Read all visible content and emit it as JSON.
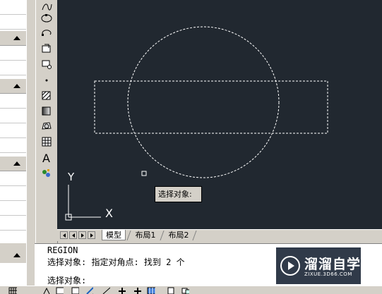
{
  "tooltip": {
    "text": "选择对象:"
  },
  "layout_tabs": {
    "model": "模型",
    "layout1": "布局1",
    "layout2": "布局2"
  },
  "command_line": {
    "history_1": "REGION",
    "history_2": "选择对象: 指定对角点: 找到 2 个",
    "prompt": "选择对象:"
  },
  "ucs": {
    "y_label": "Y",
    "x_label": "X"
  },
  "watermark": {
    "title": "溜溜自学",
    "subtitle": "ZIXUE.3D66.COM"
  },
  "draw_toolbar": {
    "tools": [
      "spline-icon",
      "ellipse-icon",
      "ellipse-arc-icon",
      "insert-block-icon",
      "make-block-icon",
      "point-icon",
      "hatch-icon",
      "gradient-icon",
      "region-icon",
      "table-icon",
      "multiline-text-icon",
      "add-selected-icon"
    ]
  },
  "colors": {
    "canvas_background": "#212830",
    "selection_dash": "#ffffff",
    "ui_face": "#d4d0c8"
  }
}
